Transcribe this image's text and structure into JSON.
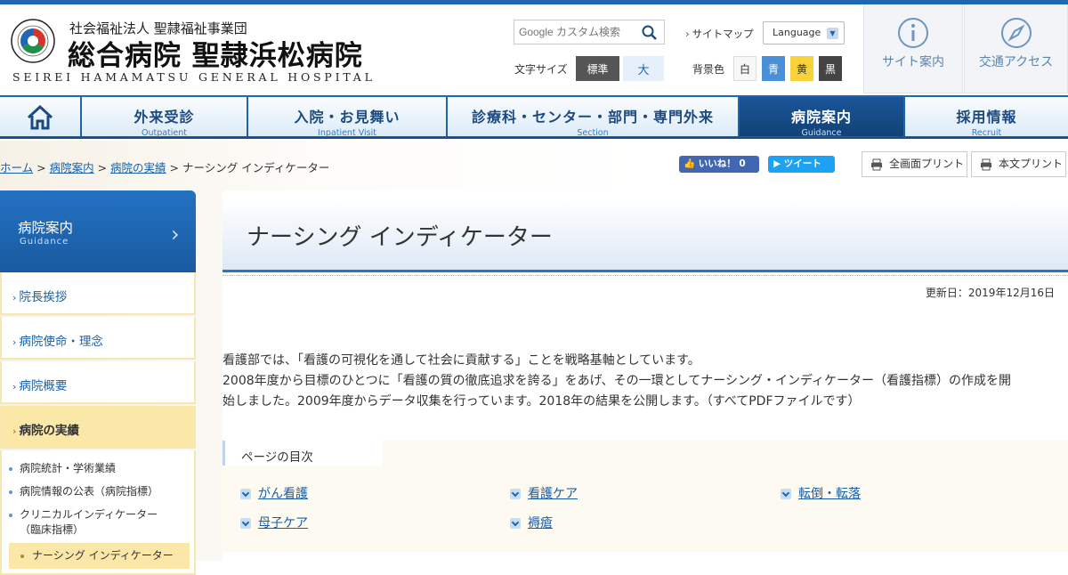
{
  "header": {
    "corp_name": "社会福祉法人 聖隷福祉事業団",
    "hospital_name": "総合病院 聖隷浜松病院",
    "hospital_name_en": "SEIREI HAMAMATSU GENERAL HOSPITAL",
    "search_placeholder": "Google カスタム検索",
    "font_size_label": "文字サイズ",
    "font_sizes": [
      "標準",
      "大"
    ],
    "sitemap": "サイトマップ",
    "language": "Language",
    "bg_color_label": "背景色",
    "bg_colors": [
      "白",
      "青",
      "黄",
      "黒"
    ],
    "site_guide": "サイト案内",
    "access": "交通アクセス"
  },
  "nav": [
    {
      "jp": "外来受診",
      "en": "Outpatient"
    },
    {
      "jp": "入院・お見舞い",
      "en": "Inpatient Visit"
    },
    {
      "jp": "診療科・センター・部門・専門外来",
      "en": "Section"
    },
    {
      "jp": "病院案内",
      "en": "Guidance"
    },
    {
      "jp": "採用情報",
      "en": "Recruit"
    }
  ],
  "breadcrumb": {
    "links": [
      "ホーム",
      "病院案内",
      "病院の実績"
    ],
    "current": "ナーシング インディケーター"
  },
  "social": {
    "like": "いいね！ 0",
    "tweet": "ツイート"
  },
  "print": {
    "full": "全画面プリント",
    "body": "本文プリント"
  },
  "sidebar": {
    "title": "病院案内",
    "title_en": "Guidance",
    "items": [
      "院長挨拶",
      "病院使命・理念",
      "病院概要",
      "病院の実績"
    ],
    "sub_items": [
      "病院統計・学術業績",
      "病院情報の公表（病院指標）",
      "クリニカルインディケーター",
      "（臨床指標）",
      "ナーシング インディケーター"
    ]
  },
  "main": {
    "title": "ナーシング インディケーター",
    "updated": "更新日：2019年12月16日",
    "intro": [
      "看護部では、「看護の可視化を通して社会に貢献する」ことを戦略基軸としています。",
      "2008年度から目標のひとつに「看護の質の徹底追求を誇る」をあげ、その一環としてナーシング・インディケーター（看護指標）の作成を開",
      "始しました。2009年度からデータ収集を行っています。2018年の結果を公開します。（すべてPDFファイルです）"
    ],
    "toc_title": "ページの目次",
    "toc": [
      "がん看護",
      "看護ケア",
      "転倒・転落",
      "母子ケア",
      "褥瘡"
    ]
  },
  "colors": {
    "brand": "#1f67b3",
    "sidebar_highlight": "#fbe7a8",
    "bg_blue": "#4a90d9",
    "bg_yellow": "#f7d23b",
    "bg_black": "#444444"
  }
}
